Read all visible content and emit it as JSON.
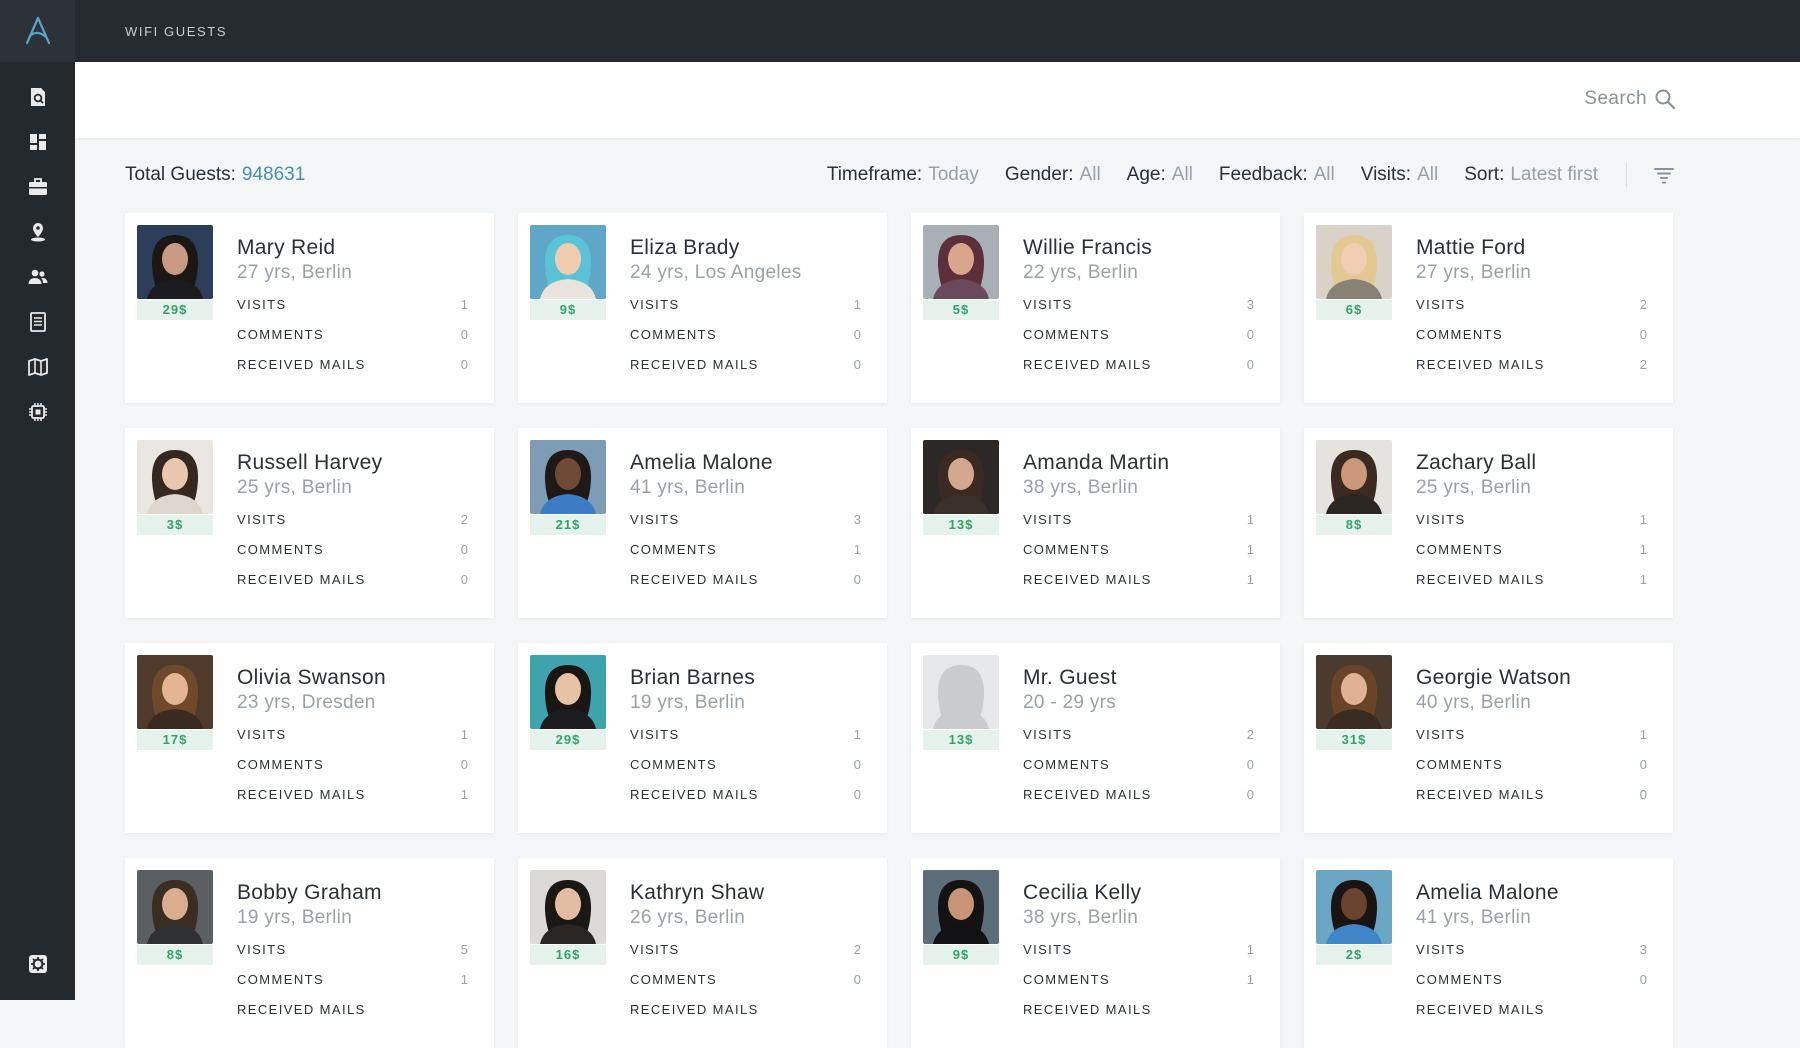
{
  "app": {
    "section_title": "WIFI GUESTS"
  },
  "nav": [
    {
      "icon": "search-doc-icon"
    },
    {
      "icon": "dashboard-icon"
    },
    {
      "icon": "briefcase-icon"
    },
    {
      "icon": "map-pin-icon"
    },
    {
      "icon": "users-icon",
      "active": true
    },
    {
      "icon": "document-icon"
    },
    {
      "icon": "map-icon"
    },
    {
      "icon": "chip-icon"
    }
  ],
  "search": {
    "label": "Search"
  },
  "summary": {
    "total_label": "Total Guests:",
    "total_value": "948631"
  },
  "filters": [
    {
      "label": "Timeframe:",
      "value": "Today"
    },
    {
      "label": "Gender:",
      "value": "All"
    },
    {
      "label": "Age:",
      "value": "All"
    },
    {
      "label": "Feedback:",
      "value": "All"
    },
    {
      "label": "Visits:",
      "value": "All"
    },
    {
      "label": "Sort:",
      "value": "Latest first"
    }
  ],
  "stat_labels": {
    "visits": "VISITS",
    "comments": "COMMENTS",
    "mails": "RECEIVED MAILS"
  },
  "colors": {
    "accent": "#4a8eb0",
    "price_text": "#34a16d",
    "price_bg": "#e4f2eb",
    "sidebar": "#24292d"
  },
  "guests": [
    {
      "name": "Mary Reid",
      "sub": "27 yrs, Berlin",
      "price": "29$",
      "visits": "1",
      "comments": "0",
      "mails": "0"
    },
    {
      "name": "Eliza Brady",
      "sub": "24 yrs, Los Angeles",
      "price": "9$",
      "visits": "1",
      "comments": "0",
      "mails": "0"
    },
    {
      "name": "Willie Francis",
      "sub": "22 yrs, Berlin",
      "price": "5$",
      "visits": "3",
      "comments": "0",
      "mails": "0"
    },
    {
      "name": "Mattie Ford",
      "sub": "27 yrs, Berlin",
      "price": "6$",
      "visits": "2",
      "comments": "0",
      "mails": "2"
    },
    {
      "name": "Russell Harvey",
      "sub": "25 yrs, Berlin",
      "price": "3$",
      "visits": "2",
      "comments": "0",
      "mails": "0"
    },
    {
      "name": "Amelia Malone",
      "sub": "41 yrs, Berlin",
      "price": "21$",
      "visits": "3",
      "comments": "1",
      "mails": "0"
    },
    {
      "name": "Amanda Martin",
      "sub": "38 yrs, Berlin",
      "price": "13$",
      "visits": "1",
      "comments": "1",
      "mails": "1"
    },
    {
      "name": "Zachary Ball",
      "sub": "25 yrs, Berlin",
      "price": "8$",
      "visits": "1",
      "comments": "1",
      "mails": "1"
    },
    {
      "name": "Olivia Swanson",
      "sub": "23 yrs, Dresden",
      "price": "17$",
      "visits": "1",
      "comments": "0",
      "mails": "1"
    },
    {
      "name": "Brian Barnes",
      "sub": "19 yrs, Berlin",
      "price": "29$",
      "visits": "1",
      "comments": "0",
      "mails": "0"
    },
    {
      "name": "Mr. Guest",
      "sub": "20 - 29 yrs",
      "price": "13$",
      "visits": "2",
      "comments": "0",
      "mails": "0"
    },
    {
      "name": "Georgie Watson",
      "sub": "40 yrs, Berlin",
      "price": "31$",
      "visits": "1",
      "comments": "0",
      "mails": "0"
    },
    {
      "name": "Bobby Graham",
      "sub": "19 yrs, Berlin",
      "price": "8$",
      "visits": "5",
      "comments": "1",
      "mails": ""
    },
    {
      "name": "Kathryn Shaw",
      "sub": "26 yrs, Berlin",
      "price": "16$",
      "visits": "2",
      "comments": "0",
      "mails": ""
    },
    {
      "name": "Cecilia Kelly",
      "sub": "38 yrs, Berlin",
      "price": "9$",
      "visits": "1",
      "comments": "1",
      "mails": ""
    },
    {
      "name": "Amelia Malone",
      "sub": "41 yrs, Berlin",
      "price": "2$",
      "visits": "3",
      "comments": "0",
      "mails": ""
    }
  ]
}
